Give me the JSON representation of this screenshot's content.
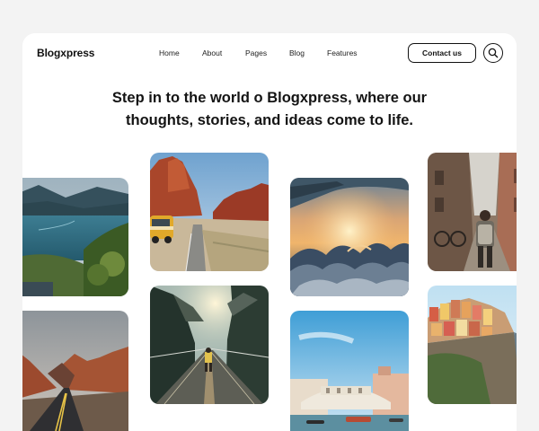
{
  "brand": "Blogxpress",
  "nav": {
    "items": [
      {
        "label": "Home"
      },
      {
        "label": "About"
      },
      {
        "label": "Pages"
      },
      {
        "label": "Blog"
      },
      {
        "label": "Features"
      }
    ],
    "contact_label": "Contact us",
    "search_icon": "search-icon"
  },
  "hero": {
    "line1": "Step in to the world o Blogxpress, where our",
    "line2": "thoughts, stories, and ideas come to life."
  },
  "gallery": [
    {
      "name": "lake-valley-photo"
    },
    {
      "name": "desert-van-road-photo"
    },
    {
      "name": "airplane-sunset-clouds-photo"
    },
    {
      "name": "alley-backpacker-photo"
    },
    {
      "name": "canyon-highway-photo"
    },
    {
      "name": "suspension-bridge-hiker-photo"
    },
    {
      "name": "venice-rialto-photo"
    },
    {
      "name": "cinque-terre-village-photo"
    }
  ]
}
